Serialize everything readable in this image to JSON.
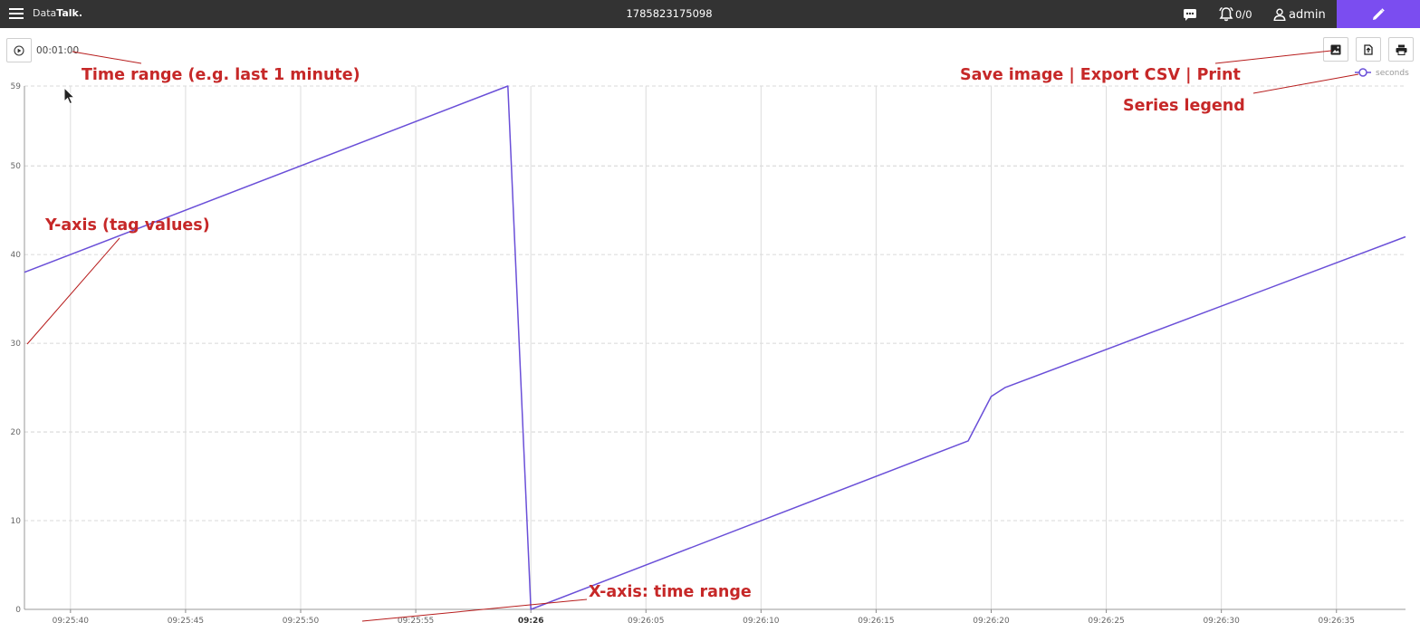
{
  "header": {
    "brand_light": "Data",
    "brand_bold": "Talk.",
    "title": "1785823175098",
    "alarm_count": "0/0",
    "user": "admin",
    "icons": [
      "menu-icon",
      "chat-icon",
      "bell-icon",
      "user-icon",
      "pencil-icon"
    ],
    "accent_color": "#7b4df0",
    "bar_color": "#333333"
  },
  "toolbar": {
    "time_range": "00:01:00",
    "icons": [
      "play-icon",
      "image-icon",
      "export-icon",
      "printer-icon"
    ]
  },
  "annotations": {
    "time_range": "Time range (e.g. last 1 minute)",
    "tools": "Save image | Export CSV | Print",
    "legend": "Series legend",
    "y_axis": "Y-axis (tag values)",
    "x_axis": "X-axis: time range"
  },
  "chart_data": {
    "type": "line",
    "title": "",
    "xlabel": "",
    "ylabel": "",
    "x_range": [
      "09:25:38",
      "09:26:38"
    ],
    "ylim": [
      0,
      59
    ],
    "y_ticks": [
      "0",
      "10",
      "20",
      "30",
      "40",
      "50",
      "59"
    ],
    "x_ticks": [
      "09:25:40",
      "09:25:45",
      "09:25:50",
      "09:25:55",
      "09:26",
      "09:26:05",
      "09:26:10",
      "09:26:15",
      "09:26:20",
      "09:26:25",
      "09:26:30",
      "09:26:35"
    ],
    "grid": true,
    "legend_position": "top-right",
    "series": [
      {
        "name": "seconds",
        "color": "#6a4fd8",
        "x": [
          "09:25:38",
          "09:25:59",
          "09:26:00",
          "09:26:19",
          "09:26:20",
          "09:26:20.6",
          "09:26:38"
        ],
        "values": [
          38,
          59,
          0,
          19,
          24,
          25,
          42
        ]
      }
    ]
  }
}
